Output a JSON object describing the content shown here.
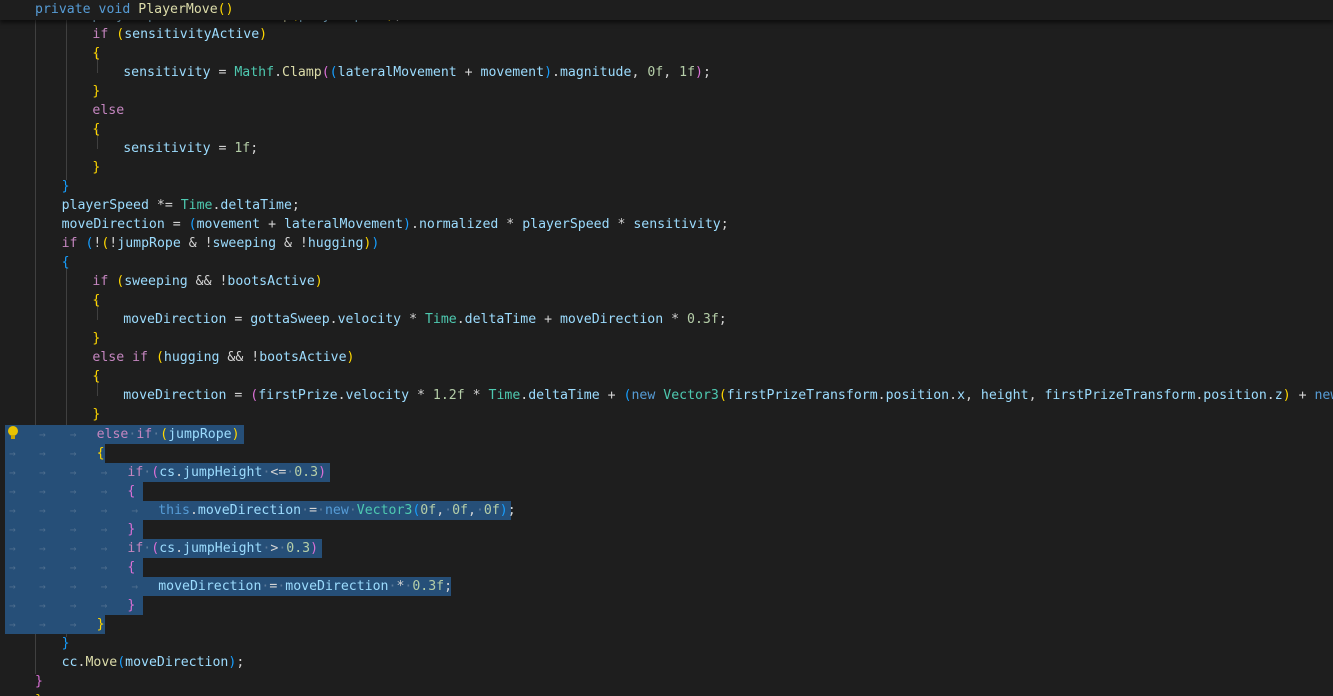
{
  "editor": {
    "sticky_header": "private void PlayerMove()",
    "partial_top_line": "playerSpeed = ...",
    "colors": {
      "background": "#1e1e1e",
      "selection": "#264f78",
      "keyword": "#569cd6",
      "control": "#c586c0",
      "variable": "#9cdcfe",
      "function": "#dcdcaa",
      "type": "#4ec9b0",
      "number": "#b5cea8"
    },
    "lightbulb_icon": "lightbulb-icon",
    "lines": [
      "if (sensitivityActive)",
      "{",
      "sensitivity = Mathf.Clamp((lateralMovement + movement).magnitude, 0f, 1f);",
      "}",
      "else",
      "{",
      "sensitivity = 1f;",
      "}",
      "}",
      "playerSpeed *= Time.deltaTime;",
      "moveDirection = (movement + lateralMovement).normalized * playerSpeed * sensitivity;",
      "if (!(!jumpRope & !sweeping & !hugging))",
      "{",
      "if (sweeping && !bootsActive)",
      "{",
      "moveDirection = gottaSweep.velocity * Time.deltaTime + moveDirection * 0.3f;",
      "}",
      "else if (hugging && !bootsActive)",
      "{",
      "moveDirection = (firstPrize.velocity * 1.2f * Time.deltaTime + (new Vector3(firstPrizeTransform.position.x, height, firstPrizeTransform.position.z) + new Vec",
      "}",
      "else if (jumpRope)",
      "{",
      "if (cs.jumpHeight <= 0.3)",
      "{",
      "this.moveDirection = new Vector3(0f, 0f, 0f);",
      "}",
      "if (cs.jumpHeight > 0.3)",
      "{",
      "moveDirection = moveDirection * 0.3f;",
      "}",
      "}",
      "}",
      "cc.Move(moveDirection);",
      "}"
    ]
  }
}
